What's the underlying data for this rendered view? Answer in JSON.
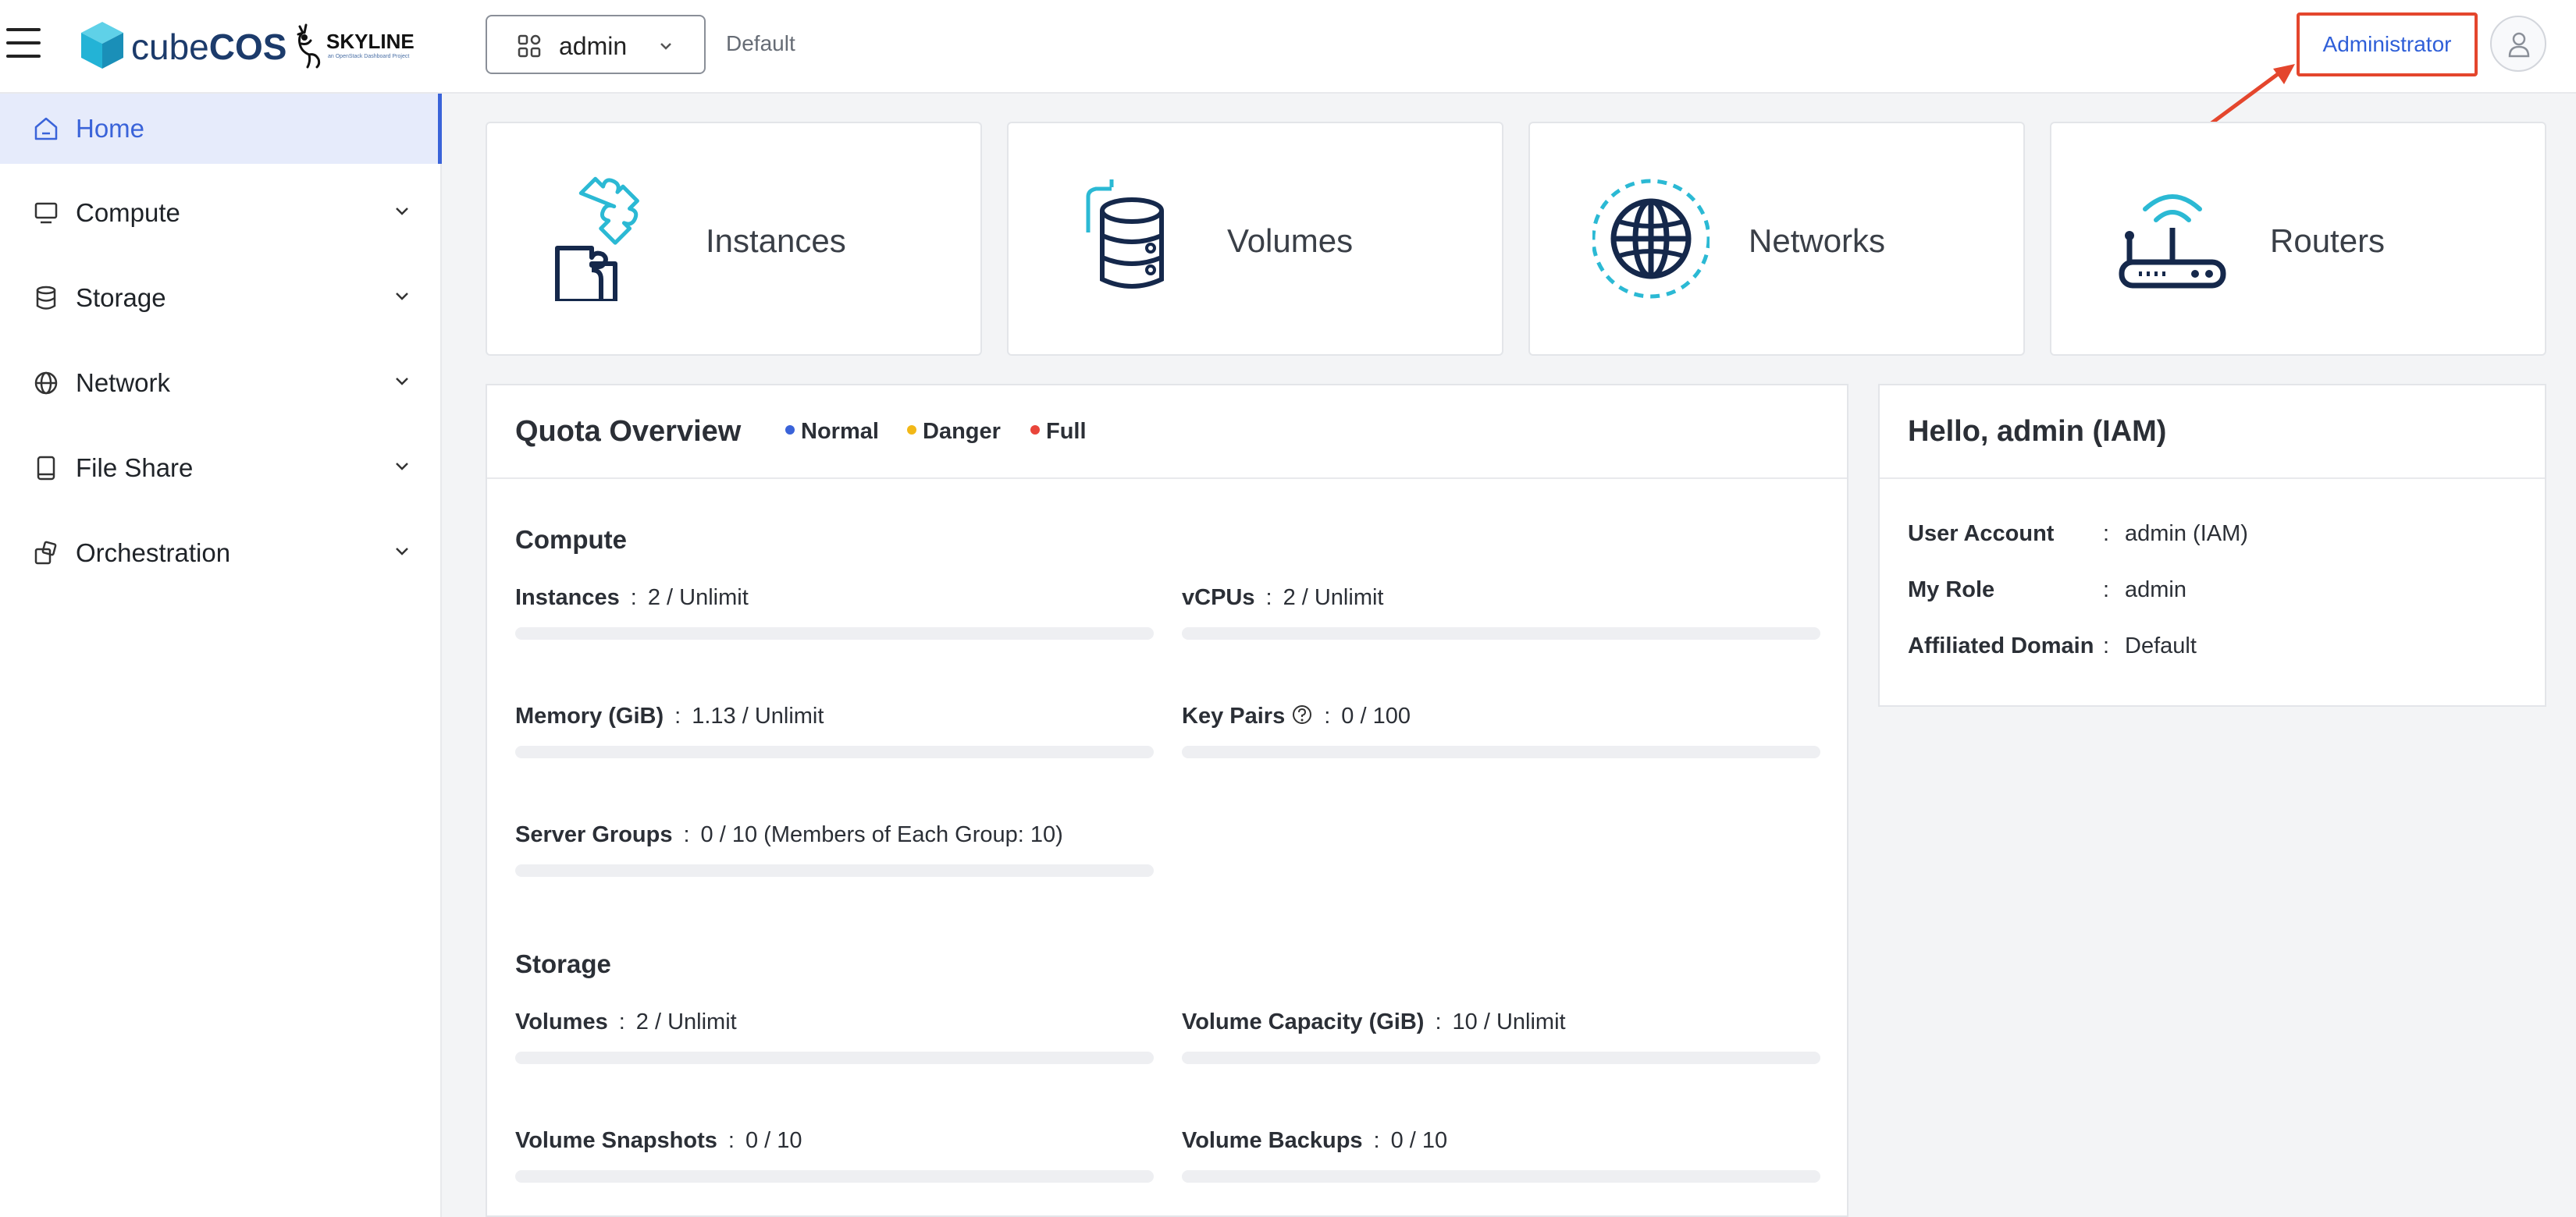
{
  "header": {
    "brand_light": "cube",
    "brand_bold": "COS",
    "skyline": "SKYLINE",
    "skyline_sub": "an OpenStack Dashboard Project",
    "project_name": "admin",
    "domain": "Default",
    "admin_button": "Administrator"
  },
  "sidebar": {
    "items": [
      {
        "label": "Home",
        "icon": "home-icon",
        "active": true
      },
      {
        "label": "Compute",
        "icon": "monitor-icon",
        "expandable": true
      },
      {
        "label": "Storage",
        "icon": "database-icon",
        "expandable": true
      },
      {
        "label": "Network",
        "icon": "globe-icon",
        "expandable": true
      },
      {
        "label": "File Share",
        "icon": "file-icon",
        "expandable": true
      },
      {
        "label": "Orchestration",
        "icon": "stack-icon",
        "expandable": true
      }
    ]
  },
  "cards": [
    {
      "label": "Instances",
      "icon": "puzzle-icon"
    },
    {
      "label": "Volumes",
      "icon": "database-icon"
    },
    {
      "label": "Networks",
      "icon": "globe-icon"
    },
    {
      "label": "Routers",
      "icon": "router-icon"
    }
  ],
  "quota": {
    "title": "Quota Overview",
    "legend": [
      {
        "label": "Normal",
        "color": "#3a63d9"
      },
      {
        "label": "Danger",
        "color": "#f2b817"
      },
      {
        "label": "Full",
        "color": "#e9453a"
      }
    ],
    "compute": {
      "title": "Compute",
      "items": [
        {
          "name": "Instances",
          "value": "2 / Unlimit",
          "fill": 0
        },
        {
          "name": "vCPUs",
          "value": "2 / Unlimit",
          "fill": 0
        },
        {
          "name": "Memory (GiB)",
          "value": "1.13 / Unlimit",
          "fill": 0
        },
        {
          "name": "Key Pairs",
          "value": "0 / 100",
          "fill": 0
        },
        {
          "name": "Server Groups",
          "value": "0 / 10 (Members of Each Group: 10)",
          "fill": 0
        }
      ]
    },
    "storage": {
      "title": "Storage",
      "items": [
        {
          "name": "Volumes",
          "value": "2 / Unlimit",
          "fill": 0
        },
        {
          "name": "Volume Capacity (GiB)",
          "value": "10 / Unlimit",
          "fill": 0
        },
        {
          "name": "Volume Snapshots",
          "value": "0 / 10",
          "fill": 0
        },
        {
          "name": "Volume Backups",
          "value": "0 / 10",
          "fill": 0
        }
      ]
    }
  },
  "hello": {
    "title": "Hello, admin (IAM)",
    "rows": [
      {
        "key": "User Account",
        "value": "admin (IAM)"
      },
      {
        "key": "My Role",
        "value": "admin"
      },
      {
        "key": "Affiliated Domain",
        "value": "Default"
      }
    ]
  },
  "colors": {
    "accent": "#3a63d9",
    "highlight_box": "#e4462d"
  }
}
